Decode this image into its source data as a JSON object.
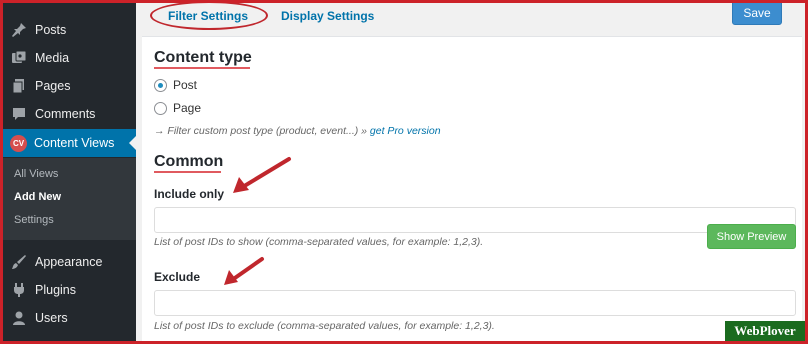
{
  "sidebar": {
    "items": [
      {
        "label": "Posts",
        "icon": "pin-icon"
      },
      {
        "label": "Media",
        "icon": "media-icon"
      },
      {
        "label": "Pages",
        "icon": "pages-icon"
      },
      {
        "label": "Comments",
        "icon": "comments-icon"
      },
      {
        "label": "Content Views",
        "icon": "cv-badge-icon",
        "badge": "CV",
        "active": true
      },
      {
        "label": "Appearance",
        "icon": "brush-icon"
      },
      {
        "label": "Plugins",
        "icon": "plugin-icon"
      },
      {
        "label": "Users",
        "icon": "users-icon"
      }
    ],
    "submenu": [
      {
        "label": "All Views"
      },
      {
        "label": "Add New",
        "current": true
      },
      {
        "label": "Settings"
      }
    ]
  },
  "tabs": [
    {
      "label": "Filter Settings",
      "active": true
    },
    {
      "label": "Display Settings"
    }
  ],
  "save_label": "Save",
  "content_type": {
    "heading": "Content type",
    "options": [
      {
        "label": "Post",
        "checked": true
      },
      {
        "label": "Page",
        "checked": false
      }
    ],
    "hint_prefix": "→ Filter custom post type (product, event...) »",
    "hint_link": "get Pro version"
  },
  "common": {
    "heading": "Common",
    "include_label": "Include only",
    "include_value": "",
    "include_hint": "List of post IDs to show (comma-separated values, for example: 1,2,3).",
    "exclude_label": "Exclude",
    "exclude_value": "",
    "exclude_hint": "List of post IDs to exclude (comma-separated values, for example: 1,2,3)."
  },
  "preview_label": "Show Preview",
  "watermark": "WebPlover",
  "colors": {
    "sidebar_bg": "#23282d",
    "active_menu": "#0073aa",
    "accent_red": "#cc2229",
    "preview_green": "#5cb85c",
    "save_blue": "#3c8dcf"
  }
}
